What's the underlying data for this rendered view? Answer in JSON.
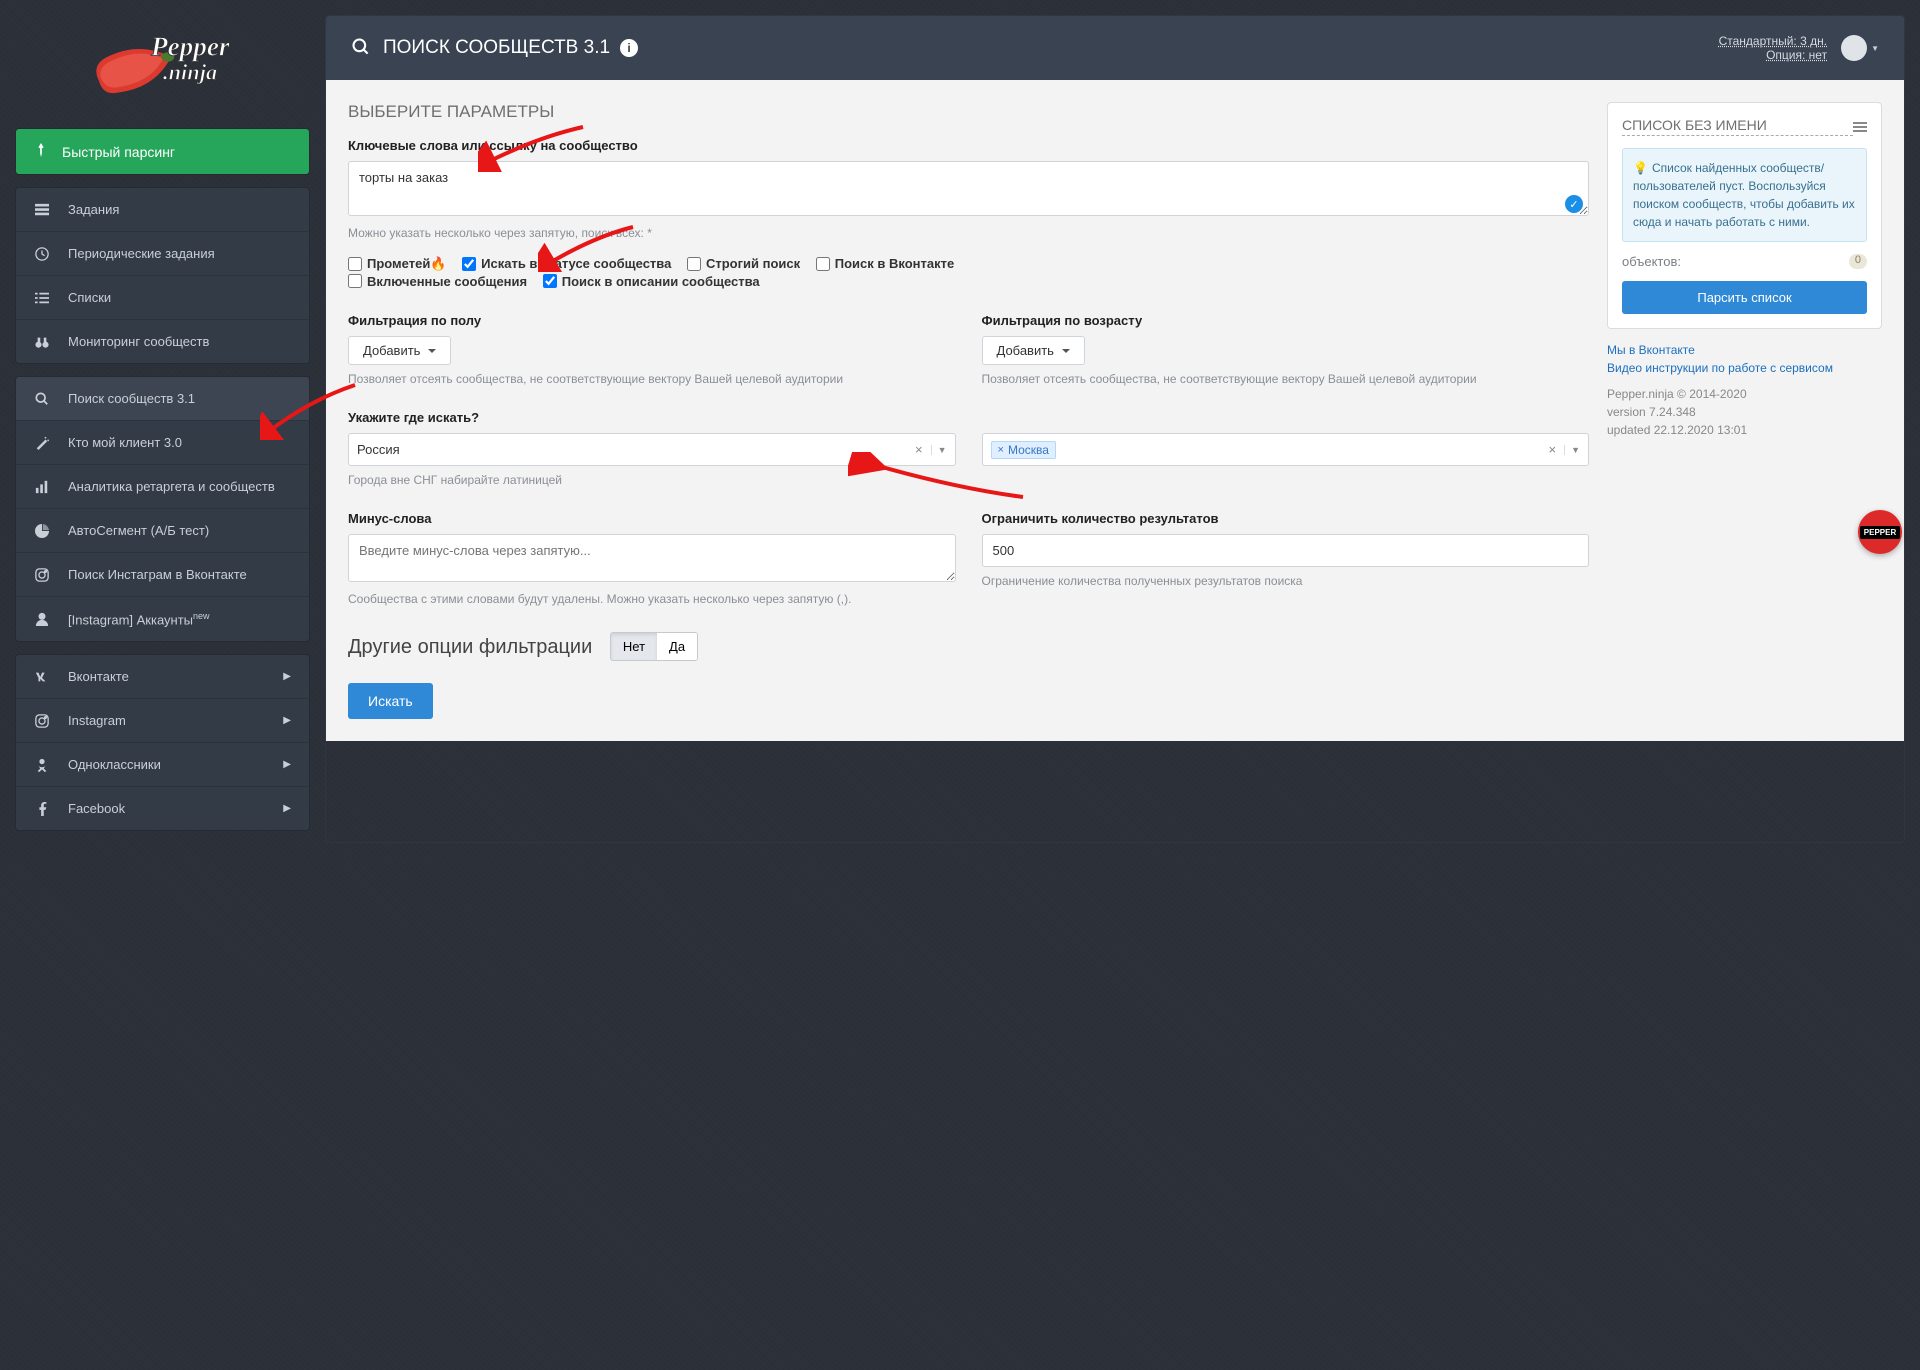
{
  "header": {
    "title": "ПОИСК СООБЩЕСТВ 3.1",
    "plan_line1": "Стандартный: 3 дн.",
    "plan_line2": "Опция: нет"
  },
  "sidebar": {
    "fast": "Быстрый парсинг",
    "group1": [
      {
        "icon": "tasks",
        "label": "Задания"
      },
      {
        "icon": "clock",
        "label": "Периодические задания"
      },
      {
        "icon": "list",
        "label": "Списки"
      },
      {
        "icon": "binoc",
        "label": "Мониторинг сообществ"
      }
    ],
    "group2": [
      {
        "icon": "search",
        "label": "Поиск сообществ 3.1",
        "active": true
      },
      {
        "icon": "wand",
        "label": "Кто мой клиент 3.0"
      },
      {
        "icon": "bars",
        "label": "Аналитика ретаргета и сообществ"
      },
      {
        "icon": "pie",
        "label": "АвтоСегмент (А/Б тест)"
      },
      {
        "icon": "insta",
        "label": "Поиск Инстаграм в Вконтакте"
      },
      {
        "icon": "user",
        "label": "[Instagram] Аккаунты",
        "badge": "new"
      }
    ],
    "group3": [
      {
        "icon": "vk",
        "label": "Вконтакте"
      },
      {
        "icon": "insta",
        "label": "Instagram"
      },
      {
        "icon": "ok",
        "label": "Одноклассники"
      },
      {
        "icon": "fb",
        "label": "Facebook"
      }
    ]
  },
  "form": {
    "section_title": "ВЫБЕРИТЕ ПАРАМЕТРЫ",
    "keywords_label": "Ключевые слова или ссылку на сообщество",
    "keywords_value": "торты на заказ",
    "keywords_hint": "Можно указать несколько через запятую, поиск всех: *",
    "checks": {
      "promethey": "Прометей",
      "status": "Искать в статусе сообщества",
      "strict": "Строгий поиск",
      "vk": "Поиск в Вконтакте",
      "msgon": "Включенные сообщения",
      "desc": "Поиск в описании сообщества"
    },
    "filter_sex_label": "Фильтрация по полу",
    "filter_age_label": "Фильтрация по возрасту",
    "add_btn": "Добавить",
    "filter_hint": "Позволяет отсеять сообщества, не соответствующие вектору Вашей целевой аудитории",
    "where_label": "Укажите где искать?",
    "country_value": "Россия",
    "city_value": "Москва",
    "where_hint": "Города вне СНГ набирайте латиницей",
    "minus_label": "Минус-слова",
    "minus_placeholder": "Введите минус-слова через запятую...",
    "minus_hint": "Сообщества с этими словами будут удалены. Можно указать несколько через запятую (,).",
    "limit_label": "Ограничить количество результатов",
    "limit_value": "500",
    "limit_hint": "Ограничение количества полученных результатов поиска",
    "other_opts": "Другие опции фильтрации",
    "no": "Нет",
    "yes": "Да",
    "search_btn": "Искать"
  },
  "rightcol": {
    "card_title": "СПИСОК БЕЗ ИМЕНИ",
    "info_text": "Список найденных сообществ/ пользователей пуст. Воспользуйся поиском сообществ, чтобы добавить их сюда и начать работать с ними.",
    "objects_label": "объектов:",
    "objects_count": "0",
    "parse_btn": "Парсить список",
    "link_vk": "Мы в Вконтакте",
    "link_video": "Видео инструкции по работе с сервисом",
    "copyright": "Pepper.ninja © 2014-2020",
    "version": "version 7.24.348",
    "updated": "updated 22.12.2020 13:01"
  },
  "pepper_badge": "PEPPER"
}
